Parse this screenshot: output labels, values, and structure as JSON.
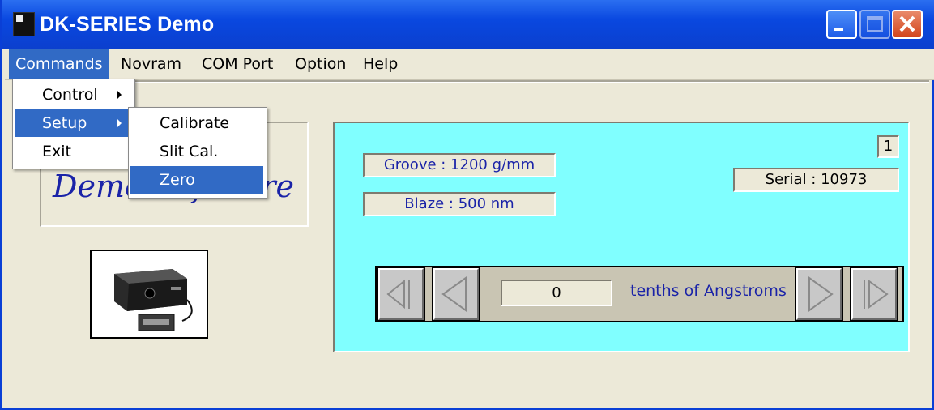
{
  "window": {
    "title": "DK-SERIES Demo"
  },
  "menubar": {
    "items": [
      "Commands",
      "Novram",
      "COM Port",
      "Option",
      "Help"
    ]
  },
  "commands_menu": {
    "items": [
      "Control",
      "Setup",
      "Exit"
    ]
  },
  "setup_submenu": {
    "items": [
      "Calibrate",
      "Slit Cal.",
      "Zero"
    ]
  },
  "left_panel": {
    "logo_text": "Demo Software"
  },
  "device_panel": {
    "groove": "Groove : 1200 g/mm",
    "blaze": "Blaze : 500 nm",
    "channel": "1",
    "serial": "Serial : 10973",
    "position_value": "0",
    "units_label": "tenths of Angstroms"
  },
  "colors": {
    "accent": "#316ac5",
    "panel": "#80ffff",
    "label_text": "#1a23a8"
  },
  "icons": [
    "app-icon",
    "minimize-icon",
    "maximize-icon",
    "close-icon",
    "submenu-arrow-icon",
    "step-back-far-icon",
    "step-back-icon",
    "step-forward-icon",
    "step-forward-far-icon"
  ]
}
